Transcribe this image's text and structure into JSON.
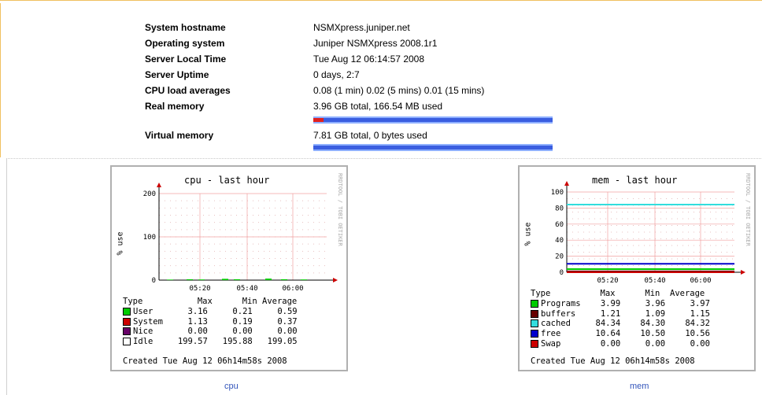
{
  "system": {
    "hostname": {
      "label": "System hostname",
      "value": "NSMXpress.juniper.net"
    },
    "os": {
      "label": "Operating system",
      "value": "Juniper NSMXpress 2008.1r1"
    },
    "time": {
      "label": "Server Local Time",
      "value": "Tue Aug 12 06:14:57 2008"
    },
    "uptime": {
      "label": "Server Uptime",
      "value": "0 days, 2:7"
    },
    "load": {
      "label": "CPU load averages",
      "value": "0.08 (1 min) 0.02 (5 mins) 0.01 (15 mins)"
    },
    "real_memory": {
      "label": "Real memory",
      "value": "3.96 GB total, 166.54 MB used",
      "used_fraction": 0.042
    },
    "virtual_memory": {
      "label": "Virtual memory",
      "value": "7.81 GB total, 0 bytes used",
      "used_fraction": 0.0
    }
  },
  "graphs": {
    "cpu": {
      "title": "cpu - last hour",
      "ylabel": "% use",
      "side_text": "RRDTOOL / TOBI OETIKER",
      "link": "cpu",
      "header": "Type           Max      Min Average",
      "created": "Created Tue Aug 12 06h14m58s 2008",
      "rows": [
        {
          "name": "User",
          "max": "3.16",
          "min": "0.21",
          "avg": "0.59",
          "color": "#00cc00"
        },
        {
          "name": "System",
          "max": "1.13",
          "min": "0.19",
          "avg": "0.37",
          "color": "#cc0000"
        },
        {
          "name": "Nice",
          "max": "0.00",
          "min": "0.00",
          "avg": "0.00",
          "color": "#660066"
        },
        {
          "name": "Idle",
          "max": "199.57",
          "min": "195.88",
          "avg": "199.05",
          "color": "#ffffff"
        }
      ],
      "chart_data": {
        "type": "area",
        "x": [
          "05:20",
          "05:40",
          "06:00"
        ],
        "yticks": [
          0,
          100,
          200
        ],
        "ylim": [
          0,
          200
        ]
      }
    },
    "mem": {
      "title": "mem - last hour",
      "ylabel": "% use",
      "side_text": "RRDTOOL / TOBI OETIKER",
      "link": "mem",
      "header": "Type          Max      Min  Average",
      "created": "Created Tue Aug 12 06h14m58s 2008",
      "rows": [
        {
          "name": "Programs",
          "max": "3.99",
          "min": "3.96",
          "avg": "3.97",
          "color": "#00cc00"
        },
        {
          "name": "buffers",
          "max": "1.21",
          "min": "1.09",
          "avg": "1.15",
          "color": "#660000"
        },
        {
          "name": "cached",
          "max": "84.34",
          "min": "84.30",
          "avg": "84.32",
          "color": "#33dddd"
        },
        {
          "name": "free",
          "max": "10.64",
          "min": "10.50",
          "avg": "10.56",
          "color": "#0000cc"
        },
        {
          "name": "Swap",
          "max": "0.00",
          "min": "0.00",
          "avg": "0.00",
          "color": "#cc0000"
        }
      ],
      "chart_data": {
        "type": "line",
        "x": [
          "05:20",
          "05:40",
          "06:00"
        ],
        "yticks": [
          0,
          20,
          40,
          60,
          80,
          100
        ],
        "ylim": [
          0,
          100
        ],
        "series": [
          {
            "name": "Programs",
            "values": [
              3.97
            ]
          },
          {
            "name": "buffers",
            "values": [
              1.15
            ]
          },
          {
            "name": "cached",
            "values": [
              84.32
            ]
          },
          {
            "name": "free",
            "values": [
              10.56
            ]
          },
          {
            "name": "Swap",
            "values": [
              0.0
            ]
          }
        ]
      }
    }
  }
}
